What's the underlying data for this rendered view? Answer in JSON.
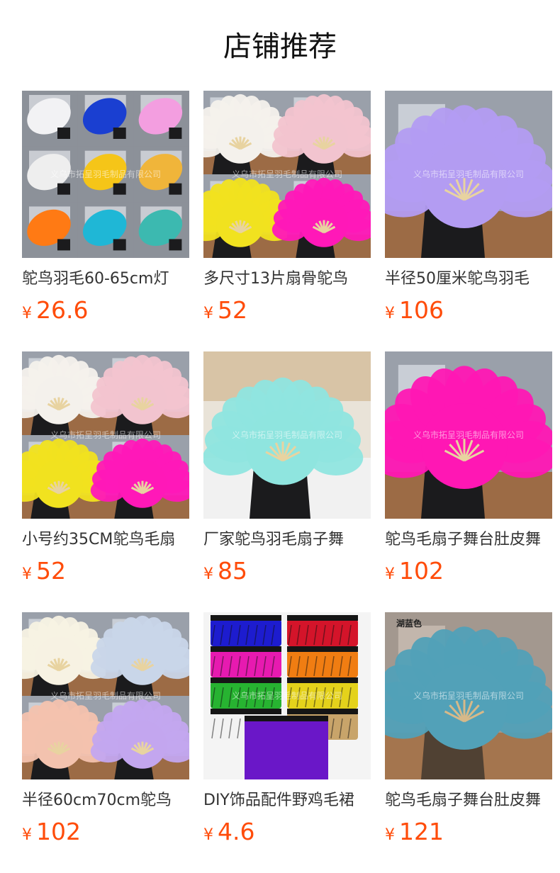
{
  "page_title": "店铺推荐",
  "currency_symbol": "¥",
  "watermark": "义乌市拓呈羽毛制品有限公司",
  "accent_color": "#ff4c0a",
  "products": [
    {
      "title": "鸵鸟羽毛60-65cm灯",
      "price": "26.6",
      "image": "ostrich-feather-color-grid",
      "colors": [
        "#f2f2f4",
        "#1a3fd1",
        "#f39ee0",
        "#eeeeee",
        "#f5c518",
        "#f0b53a",
        "#ff7a14",
        "#1fb7d6",
        "#3cb9b0"
      ]
    },
    {
      "title": "多尺寸13片扇骨鸵鸟",
      "price": "52",
      "image": "feather-fan-four-colors",
      "colors": [
        "#f4f1ec",
        "#f2c4cf",
        "#f1e21f",
        "#ff18b8"
      ]
    },
    {
      "title": "半径50厘米鸵鸟羽毛",
      "price": "106",
      "image": "lavender-feather-fan",
      "colors": [
        "#b39cf2"
      ]
    },
    {
      "title": "小号约35CM鸵鸟毛扇",
      "price": "52",
      "image": "feather-fan-four-colors",
      "colors": [
        "#f4f1ec",
        "#f2c4cf",
        "#f1e21f",
        "#ff18b8"
      ]
    },
    {
      "title": "厂家鸵鸟羽毛扇子舞",
      "price": "85",
      "image": "mint-feather-fan-kitchen",
      "colors": [
        "#8fe5df"
      ]
    },
    {
      "title": "鸵鸟毛扇子舞台肚皮舞",
      "price": "102",
      "image": "magenta-feather-fan",
      "colors": [
        "#ff17b4"
      ]
    },
    {
      "title": "半径60cm70cm鸵鸟",
      "price": "102",
      "image": "feather-fan-four-pastels",
      "colors": [
        "#f7f2e3",
        "#c9d6e9",
        "#f3c2ae",
        "#c3a6ef"
      ]
    },
    {
      "title": "DIY饰品配件野鸡毛裙",
      "price": "4.6",
      "image": "pheasant-feather-trim",
      "colors": [
        "#1d1ccf",
        "#d4142a",
        "#e71ab0",
        "#f07d12",
        "#27b331",
        "#e4d21b",
        "#f2f2f2",
        "#c8a46a",
        "#6a17c8"
      ]
    },
    {
      "title": "鸵鸟毛扇子舞台肚皮舞",
      "price": "121",
      "image": "lake-blue-feather-fan",
      "label": "湖蓝色",
      "colors": [
        "#1eaee8"
      ]
    }
  ]
}
